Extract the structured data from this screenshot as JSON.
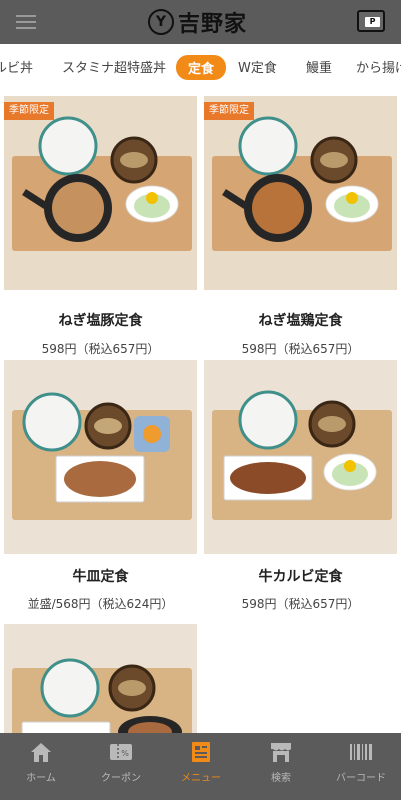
{
  "header": {
    "menu_icon": "hamburger-icon",
    "logo_mark": "Y",
    "logo_text": "吉野家",
    "wallet_icon": "wallet-icon",
    "wallet_label": "P"
  },
  "tabs": [
    {
      "label": "ルビ丼",
      "active": false
    },
    {
      "label": "スタミナ超特盛丼",
      "active": false
    },
    {
      "label": "定食",
      "active": true
    },
    {
      "label": "W定食",
      "active": false
    },
    {
      "label": "鰻重",
      "active": false
    },
    {
      "label": "から揚げ",
      "active": false
    }
  ],
  "products": [
    {
      "badge": "季節限定",
      "name": "ねぎ塩豚定食",
      "price": "598円（税込657円）"
    },
    {
      "badge": "季節限定",
      "name": "ねぎ塩鶏定食",
      "price": "598円（税込657円）"
    },
    {
      "badge": "",
      "name": "牛皿定食",
      "price": "並盛/568円（税込624円）"
    },
    {
      "badge": "",
      "name": "牛カルビ定食",
      "price": "598円（税込657円）"
    },
    {
      "badge": "",
      "name": "",
      "price": ""
    }
  ],
  "bottom_nav": [
    {
      "label": "ホーム",
      "icon": "home-icon",
      "active": false
    },
    {
      "label": "クーポン",
      "icon": "coupon-icon",
      "active": false
    },
    {
      "label": "メニュー",
      "icon": "menu-book-icon",
      "active": true
    },
    {
      "label": "検索",
      "icon": "store-icon",
      "active": false
    },
    {
      "label": "バーコード",
      "icon": "barcode-icon",
      "active": false
    }
  ],
  "colors": {
    "accent": "#f28a18",
    "header_bg": "#5b5b5b",
    "badge_bg": "#e8782a"
  }
}
